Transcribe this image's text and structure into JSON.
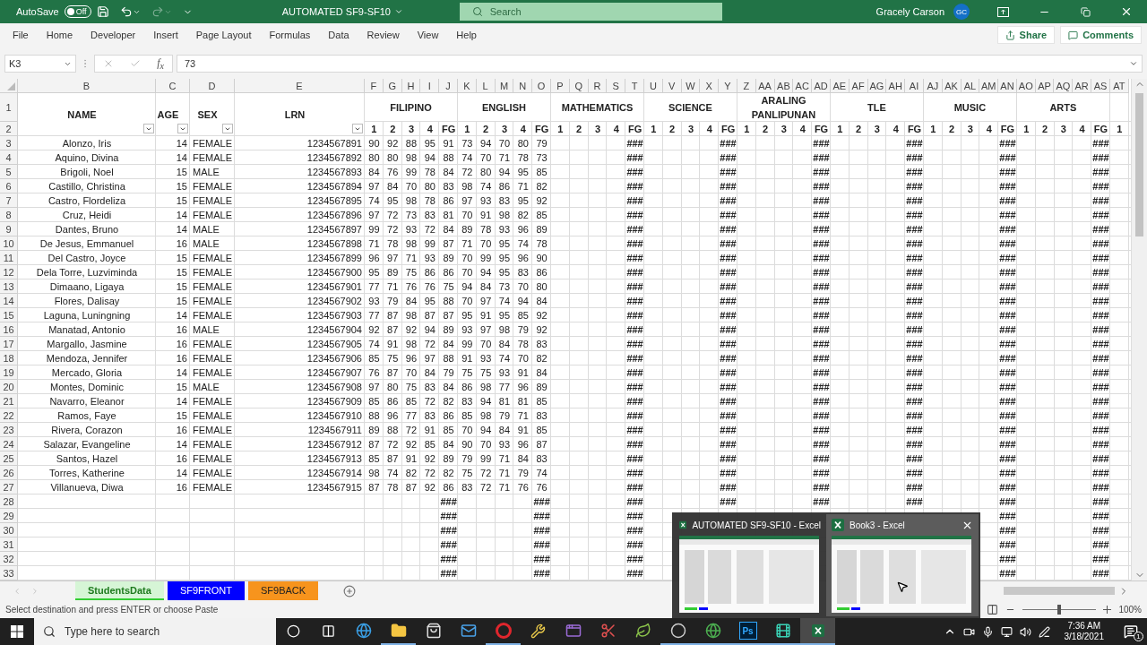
{
  "title_bar": {
    "autosave_label": "AutoSave",
    "autosave_on": false,
    "autosave_state": "Off",
    "document_title": "AUTOMATED SF9-SF10",
    "search_placeholder": "Search",
    "user_name": "Gracely Carson",
    "user_initials": "GC"
  },
  "ribbon_tabs": [
    "File",
    "Home",
    "Developer",
    "Insert",
    "Page Layout",
    "Formulas",
    "Data",
    "Review",
    "View",
    "Help"
  ],
  "ribbon_actions": {
    "share": "Share",
    "comments": "Comments"
  },
  "formula_bar": {
    "cell_ref": "K3",
    "function_label": "f$_{x}$",
    "formula": "73"
  },
  "sheet": {
    "info_columns": [
      {
        "letter": "B",
        "heading": "NAME",
        "filter": true
      },
      {
        "letter": "C",
        "heading": "AGE",
        "filter": true
      },
      {
        "letter": "D",
        "heading": "SEX",
        "filter": true
      },
      {
        "letter": "E",
        "heading": "LRN",
        "filter": true
      }
    ],
    "grade_letters": [
      "F",
      "G",
      "H",
      "I",
      "J",
      "K",
      "L",
      "M",
      "N",
      "O",
      "P",
      "Q",
      "R",
      "S",
      "T",
      "U",
      "V",
      "W",
      "X",
      "Y",
      "Z",
      "AA",
      "AB",
      "AC",
      "AD",
      "AE",
      "AF",
      "AG",
      "AH",
      "AI",
      "AJ",
      "AK",
      "AL",
      "AM",
      "AN",
      "AO",
      "AP",
      "AQ",
      "AR",
      "AS",
      "AT"
    ],
    "subjects": [
      {
        "label": "FILIPINO",
        "columns": [
          "1",
          "2",
          "3",
          "4",
          "FG"
        ]
      },
      {
        "label": "ENGLISH",
        "columns": [
          "1",
          "2",
          "3",
          "4",
          "FG"
        ]
      },
      {
        "label": "MATHEMATICS",
        "columns": [
          "1",
          "2",
          "3",
          "4",
          "FG"
        ]
      },
      {
        "label": "SCIENCE",
        "columns": [
          "1",
          "2",
          "3",
          "4",
          "FG"
        ]
      },
      {
        "label": "ARALING PANLIPUNAN",
        "columns": [
          "1",
          "2",
          "3",
          "4",
          "FG"
        ]
      },
      {
        "label": "TLE",
        "columns": [
          "1",
          "2",
          "3",
          "4",
          "FG"
        ]
      },
      {
        "label": "MUSIC",
        "columns": [
          "1",
          "2",
          "3",
          "4",
          "FG"
        ]
      },
      {
        "label": "ARTS",
        "columns": [
          "1",
          "2",
          "3",
          "4",
          "FG"
        ]
      },
      {
        "columns": [
          "1"
        ]
      }
    ],
    "header_rows": [
      "1",
      "2"
    ],
    "rows": [
      {
        "number": "3",
        "name": "Alonzo, Iris",
        "age": "14",
        "sex": "FEMALE",
        "lrn": "1234567891",
        "quarters": [
          [
            "90",
            "92",
            "88",
            "95"
          ],
          [
            "73",
            "94",
            "70",
            "80"
          ]
        ],
        "fg": [
          "91",
          "79",
          "###",
          "###",
          "###",
          "###",
          "###",
          "###"
        ]
      },
      {
        "number": "4",
        "name": "Aquino, Divina",
        "age": "14",
        "sex": "FEMALE",
        "lrn": "1234567892",
        "quarters": [
          [
            "80",
            "80",
            "98",
            "94"
          ],
          [
            "74",
            "70",
            "71",
            "78"
          ]
        ],
        "fg": [
          "88",
          "73",
          "###",
          "###",
          "###",
          "###",
          "###",
          "###"
        ]
      },
      {
        "number": "5",
        "name": "Brigoli, Noel",
        "age": "15",
        "sex": "MALE",
        "lrn": "1234567893",
        "quarters": [
          [
            "84",
            "76",
            "99",
            "78"
          ],
          [
            "72",
            "80",
            "94",
            "95"
          ]
        ],
        "fg": [
          "84",
          "85",
          "###",
          "###",
          "###",
          "###",
          "###",
          "###"
        ]
      },
      {
        "number": "6",
        "name": "Castillo, Christina",
        "age": "15",
        "sex": "FEMALE",
        "lrn": "1234567894",
        "quarters": [
          [
            "97",
            "84",
            "70",
            "80"
          ],
          [
            "98",
            "74",
            "86",
            "71"
          ]
        ],
        "fg": [
          "83",
          "82",
          "###",
          "###",
          "###",
          "###",
          "###",
          "###"
        ]
      },
      {
        "number": "7",
        "name": "Castro, Flordeliza",
        "age": "15",
        "sex": "FEMALE",
        "lrn": "1234567895",
        "quarters": [
          [
            "74",
            "95",
            "98",
            "78"
          ],
          [
            "97",
            "93",
            "83",
            "95"
          ]
        ],
        "fg": [
          "86",
          "92",
          "###",
          "###",
          "###",
          "###",
          "###",
          "###"
        ]
      },
      {
        "number": "8",
        "name": "Cruz, Heidi",
        "age": "14",
        "sex": "FEMALE",
        "lrn": "1234567896",
        "quarters": [
          [
            "97",
            "72",
            "73",
            "83"
          ],
          [
            "70",
            "91",
            "98",
            "82"
          ]
        ],
        "fg": [
          "81",
          "85",
          "###",
          "###",
          "###",
          "###",
          "###",
          "###"
        ]
      },
      {
        "number": "9",
        "name": "Dantes, Bruno",
        "age": "14",
        "sex": "MALE",
        "lrn": "1234567897",
        "quarters": [
          [
            "99",
            "72",
            "93",
            "72"
          ],
          [
            "89",
            "78",
            "93",
            "96"
          ]
        ],
        "fg": [
          "84",
          "89",
          "###",
          "###",
          "###",
          "###",
          "###",
          "###"
        ]
      },
      {
        "number": "10",
        "name": "De Jesus, Emmanuel",
        "age": "16",
        "sex": "MALE",
        "lrn": "1234567898",
        "quarters": [
          [
            "71",
            "78",
            "98",
            "99"
          ],
          [
            "71",
            "70",
            "95",
            "74"
          ]
        ],
        "fg": [
          "87",
          "78",
          "###",
          "###",
          "###",
          "###",
          "###",
          "###"
        ]
      },
      {
        "number": "11",
        "name": "Del Castro, Joyce",
        "age": "15",
        "sex": "FEMALE",
        "lrn": "1234567899",
        "quarters": [
          [
            "96",
            "97",
            "71",
            "93"
          ],
          [
            "70",
            "99",
            "95",
            "96"
          ]
        ],
        "fg": [
          "89",
          "90",
          "###",
          "###",
          "###",
          "###",
          "###",
          "###"
        ]
      },
      {
        "number": "12",
        "name": "Dela Torre, Luzviminda",
        "age": "15",
        "sex": "FEMALE",
        "lrn": "1234567900",
        "quarters": [
          [
            "95",
            "89",
            "75",
            "86"
          ],
          [
            "70",
            "94",
            "95",
            "83"
          ]
        ],
        "fg": [
          "86",
          "86",
          "###",
          "###",
          "###",
          "###",
          "###",
          "###"
        ]
      },
      {
        "number": "13",
        "name": "Dimaano, Ligaya",
        "age": "15",
        "sex": "FEMALE",
        "lrn": "1234567901",
        "quarters": [
          [
            "77",
            "71",
            "76",
            "76"
          ],
          [
            "94",
            "84",
            "73",
            "70"
          ]
        ],
        "fg": [
          "75",
          "80",
          "###",
          "###",
          "###",
          "###",
          "###",
          "###"
        ]
      },
      {
        "number": "14",
        "name": "Flores, Dalisay",
        "age": "15",
        "sex": "FEMALE",
        "lrn": "1234567902",
        "quarters": [
          [
            "93",
            "79",
            "84",
            "95"
          ],
          [
            "70",
            "97",
            "74",
            "94"
          ]
        ],
        "fg": [
          "88",
          "84",
          "###",
          "###",
          "###",
          "###",
          "###",
          "###"
        ]
      },
      {
        "number": "15",
        "name": "Laguna, Luningning",
        "age": "14",
        "sex": "FEMALE",
        "lrn": "1234567903",
        "quarters": [
          [
            "77",
            "87",
            "98",
            "87"
          ],
          [
            "95",
            "91",
            "95",
            "85"
          ]
        ],
        "fg": [
          "87",
          "92",
          "###",
          "###",
          "###",
          "###",
          "###",
          "###"
        ]
      },
      {
        "number": "16",
        "name": "Manatad, Antonio",
        "age": "16",
        "sex": "MALE",
        "lrn": "1234567904",
        "quarters": [
          [
            "92",
            "87",
            "92",
            "94"
          ],
          [
            "93",
            "97",
            "98",
            "79"
          ]
        ],
        "fg": [
          "89",
          "92",
          "###",
          "###",
          "###",
          "###",
          "###",
          "###"
        ]
      },
      {
        "number": "17",
        "name": "Margallo, Jasmine",
        "age": "16",
        "sex": "FEMALE",
        "lrn": "1234567905",
        "quarters": [
          [
            "74",
            "91",
            "98",
            "72"
          ],
          [
            "99",
            "70",
            "84",
            "78"
          ]
        ],
        "fg": [
          "84",
          "83",
          "###",
          "###",
          "###",
          "###",
          "###",
          "###"
        ]
      },
      {
        "number": "18",
        "name": "Mendoza, Jennifer",
        "age": "16",
        "sex": "FEMALE",
        "lrn": "1234567906",
        "quarters": [
          [
            "85",
            "75",
            "96",
            "97"
          ],
          [
            "91",
            "93",
            "74",
            "70"
          ]
        ],
        "fg": [
          "88",
          "82",
          "###",
          "###",
          "###",
          "###",
          "###",
          "###"
        ]
      },
      {
        "number": "19",
        "name": "Mercado, Gloria",
        "age": "14",
        "sex": "FEMALE",
        "lrn": "1234567907",
        "quarters": [
          [
            "76",
            "87",
            "70",
            "84"
          ],
          [
            "75",
            "75",
            "93",
            "91"
          ]
        ],
        "fg": [
          "79",
          "84",
          "###",
          "###",
          "###",
          "###",
          "###",
          "###"
        ]
      },
      {
        "number": "20",
        "name": "Montes, Dominic",
        "age": "15",
        "sex": "MALE",
        "lrn": "1234567908",
        "quarters": [
          [
            "97",
            "80",
            "75",
            "83"
          ],
          [
            "86",
            "98",
            "77",
            "96"
          ]
        ],
        "fg": [
          "84",
          "89",
          "###",
          "###",
          "###",
          "###",
          "###",
          "###"
        ]
      },
      {
        "number": "21",
        "name": "Navarro, Eleanor",
        "age": "14",
        "sex": "FEMALE",
        "lrn": "1234567909",
        "quarters": [
          [
            "85",
            "86",
            "85",
            "72"
          ],
          [
            "83",
            "94",
            "81",
            "81"
          ]
        ],
        "fg": [
          "82",
          "85",
          "###",
          "###",
          "###",
          "###",
          "###",
          "###"
        ]
      },
      {
        "number": "22",
        "name": "Ramos, Faye",
        "age": "15",
        "sex": "FEMALE",
        "lrn": "1234567910",
        "quarters": [
          [
            "88",
            "96",
            "77",
            "83"
          ],
          [
            "85",
            "98",
            "79",
            "71"
          ]
        ],
        "fg": [
          "86",
          "83",
          "###",
          "###",
          "###",
          "###",
          "###",
          "###"
        ]
      },
      {
        "number": "23",
        "name": "Rivera, Corazon",
        "age": "16",
        "sex": "FEMALE",
        "lrn": "1234567911",
        "quarters": [
          [
            "89",
            "88",
            "72",
            "91"
          ],
          [
            "70",
            "94",
            "84",
            "91"
          ]
        ],
        "fg": [
          "85",
          "85",
          "###",
          "###",
          "###",
          "###",
          "###",
          "###"
        ]
      },
      {
        "number": "24",
        "name": "Salazar, Evangeline",
        "age": "14",
        "sex": "FEMALE",
        "lrn": "1234567912",
        "quarters": [
          [
            "87",
            "72",
            "92",
            "85"
          ],
          [
            "90",
            "70",
            "93",
            "96"
          ]
        ],
        "fg": [
          "84",
          "87",
          "###",
          "###",
          "###",
          "###",
          "###",
          "###"
        ]
      },
      {
        "number": "25",
        "name": "Santos, Hazel",
        "age": "16",
        "sex": "FEMALE",
        "lrn": "1234567913",
        "quarters": [
          [
            "85",
            "87",
            "91",
            "92"
          ],
          [
            "79",
            "99",
            "71",
            "84"
          ]
        ],
        "fg": [
          "89",
          "83",
          "###",
          "###",
          "###",
          "###",
          "###",
          "###"
        ]
      },
      {
        "number": "26",
        "name": "Torres, Katherine",
        "age": "14",
        "sex": "FEMALE",
        "lrn": "1234567914",
        "quarters": [
          [
            "98",
            "74",
            "82",
            "72"
          ],
          [
            "75",
            "72",
            "71",
            "79"
          ]
        ],
        "fg": [
          "82",
          "74",
          "###",
          "###",
          "###",
          "###",
          "###",
          "###"
        ]
      },
      {
        "number": "27",
        "name": "Villanueva, Diwa",
        "age": "16",
        "sex": "FEMALE",
        "lrn": "1234567915",
        "quarters": [
          [
            "87",
            "78",
            "87",
            "92"
          ],
          [
            "83",
            "72",
            "71",
            "76"
          ]
        ],
        "fg": [
          "86",
          "76",
          "###",
          "###",
          "###",
          "###",
          "###",
          "###"
        ]
      },
      {
        "number": "28",
        "fg": [
          "###",
          "###",
          "###",
          "###",
          "###",
          "###",
          "###",
          "###"
        ]
      },
      {
        "number": "29",
        "fg": [
          "###",
          "###",
          "###"
        ],
        "fg_end": [
          "###",
          "###"
        ]
      },
      {
        "number": "30",
        "fg": [
          "###",
          "###",
          "###"
        ],
        "fg_end": [
          "###",
          "###"
        ]
      },
      {
        "number": "31",
        "fg": [
          "###",
          "###",
          "###"
        ],
        "fg_end": [
          "###",
          "###"
        ]
      },
      {
        "number": "32",
        "fg": [
          "###",
          "###",
          "###"
        ],
        "fg_end": [
          "###",
          "###"
        ]
      },
      {
        "number": "33",
        "fg": [
          "###",
          "###",
          "###"
        ],
        "fg_end": [
          "###",
          "###"
        ]
      }
    ]
  },
  "sheet_tabs": [
    {
      "label": "StudentsData",
      "selected": true,
      "color": "#33cc33"
    },
    {
      "label": "SF9FRONT",
      "selected": false,
      "color": "#0000ff"
    },
    {
      "label": "SF9BACK",
      "selected": false,
      "color": "#f7941d"
    }
  ],
  "status_bar": {
    "message": "Select destination and press ENTER or choose Paste",
    "zoom": "100%",
    "zoom_slider": {
      "level": 0.5
    }
  },
  "window_previews": [
    {
      "title": "AUTOMATED SF9-SF10 - Excel",
      "hovered": false
    },
    {
      "title": "Book3 - Excel",
      "hovered": true
    }
  ],
  "taskbar": {
    "search_placeholder": "Type here to search",
    "apps": [
      {
        "kind": "edge",
        "running": false,
        "active": false
      },
      {
        "kind": "explorer",
        "running": true,
        "active": false
      },
      {
        "kind": "store",
        "running": false,
        "active": false
      },
      {
        "kind": "mail",
        "running": false,
        "active": false
      },
      {
        "kind": "opera",
        "running": true,
        "active": false
      },
      {
        "kind": "tool",
        "running": false,
        "active": false
      },
      {
        "kind": "vs",
        "running": false,
        "active": false
      },
      {
        "kind": "snip",
        "running": false,
        "active": false
      },
      {
        "kind": "leaf",
        "running": false,
        "active": false
      },
      {
        "kind": "obs",
        "running": true,
        "active": false
      },
      {
        "kind": "chrome",
        "running": true,
        "active": false
      },
      {
        "kind": "photoshop",
        "label": "Ps",
        "running": true,
        "active": false
      },
      {
        "kind": "filmora",
        "running": true,
        "active": false
      },
      {
        "kind": "excel",
        "running": true,
        "active": true
      }
    ],
    "time": "7:36 AM",
    "date": "3/18/2021",
    "notification_count": "1"
  }
}
